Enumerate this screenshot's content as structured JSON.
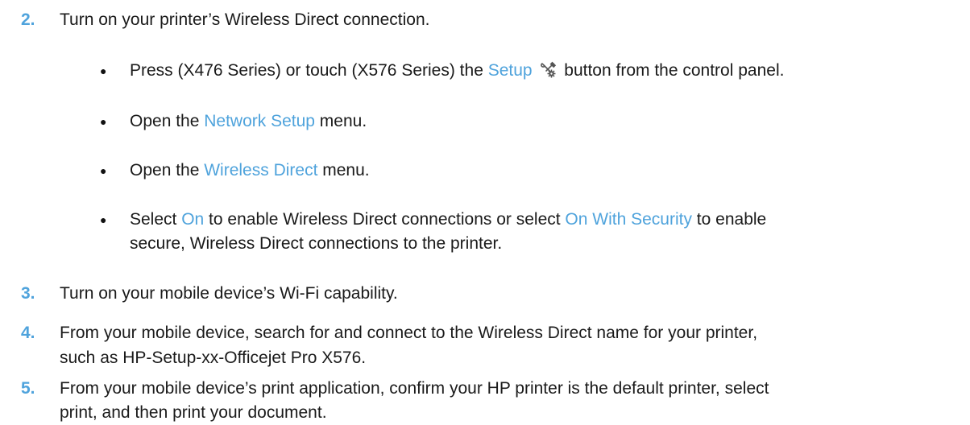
{
  "step2": {
    "number": "2.",
    "text": "Turn on your printer’s Wireless Direct connection.",
    "bullets": [
      {
        "pre": "Press (X476 Series) or touch (X576 Series) the ",
        "link": "Setup",
        "icon": "setup-wrench-gear-icon",
        "post": " button from the control panel."
      },
      {
        "pre": "Open the ",
        "link": "Network Setup",
        "post": " menu."
      },
      {
        "pre": "Open the ",
        "link": "Wireless Direct",
        "post": " menu."
      },
      {
        "pre": "Select ",
        "link": "On",
        "mid": " to enable Wireless Direct connections or select ",
        "link2": "On With Security",
        "post": " to enable",
        "line2": "secure, Wireless Direct connections to the printer."
      }
    ]
  },
  "step3": {
    "number": "3.",
    "text": "Turn on your mobile device’s Wi-Fi capability."
  },
  "step4": {
    "number": "4.",
    "line1": "From your mobile device, search for and connect to the Wireless Direct name for your printer,",
    "line2": "such as HP-Setup-xx-Officejet Pro X576."
  },
  "step5": {
    "number": "5.",
    "line1": "From your mobile device’s print application, confirm your HP printer is the default printer, select",
    "line2": "print, and then print your document."
  },
  "colors": {
    "accent": "#4fa3dc",
    "text": "#1a1a1a"
  }
}
